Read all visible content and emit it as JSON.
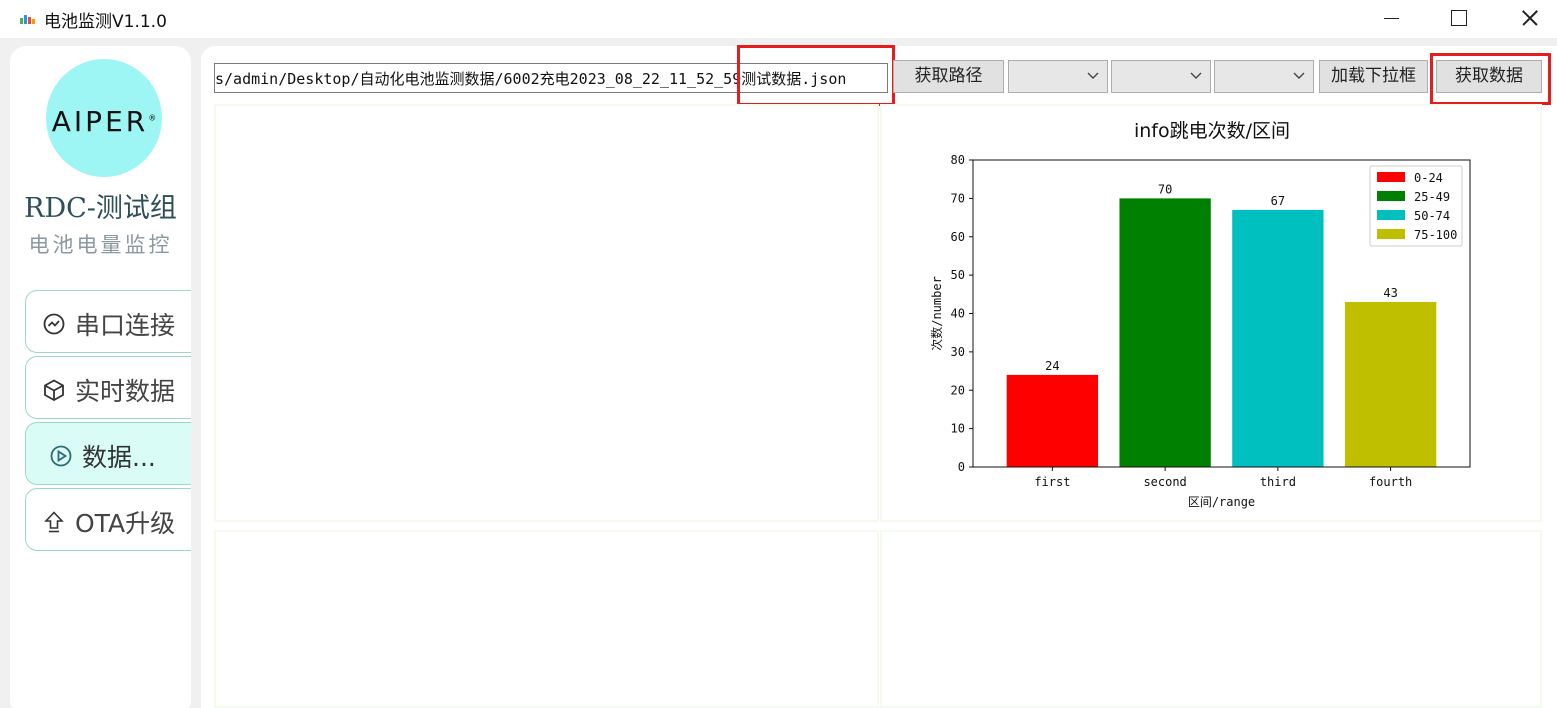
{
  "window": {
    "title": "电池监测V1.1.0"
  },
  "sidebar": {
    "logo_text": "AIPER",
    "team": "RDC-测试组",
    "subtitle": "电池电量监控",
    "items": [
      {
        "label": "串口连接",
        "icon": "chart-circle-icon"
      },
      {
        "label": "实时数据",
        "icon": "cube-icon"
      },
      {
        "label": "数据...",
        "icon": "play-circle-icon",
        "active": true
      },
      {
        "label": "OTA升级",
        "icon": "upload-arrow-icon"
      }
    ]
  },
  "toolbar": {
    "path_value": "s/admin/Desktop/自动化电池监测数据/6002充电2023_08_22_11_52_59测试数据.json",
    "get_path_label": "获取路径",
    "combo1_value": "",
    "combo2_value": "",
    "combo3_value": "",
    "load_dropdown_label": "加载下拉框",
    "get_data_label": "获取数据",
    "highlight_color": "#e51d1d"
  },
  "chart_data": {
    "type": "bar",
    "title": "info跳电次数/区间",
    "xlabel": "区间/range",
    "ylabel": "次数/number",
    "categories": [
      "first",
      "second",
      "third",
      "fourth"
    ],
    "values": [
      24,
      70,
      67,
      43
    ],
    "colors": [
      "#ff0000",
      "#008000",
      "#00bfbf",
      "#bfbf00"
    ],
    "legend": [
      "0-24",
      "25-49",
      "50-74",
      "75-100"
    ],
    "legend_position": "top-right",
    "ylim": [
      0,
      80
    ],
    "yticks": [
      0,
      10,
      20,
      30,
      40,
      50,
      60,
      70,
      80
    ],
    "grid": false
  }
}
